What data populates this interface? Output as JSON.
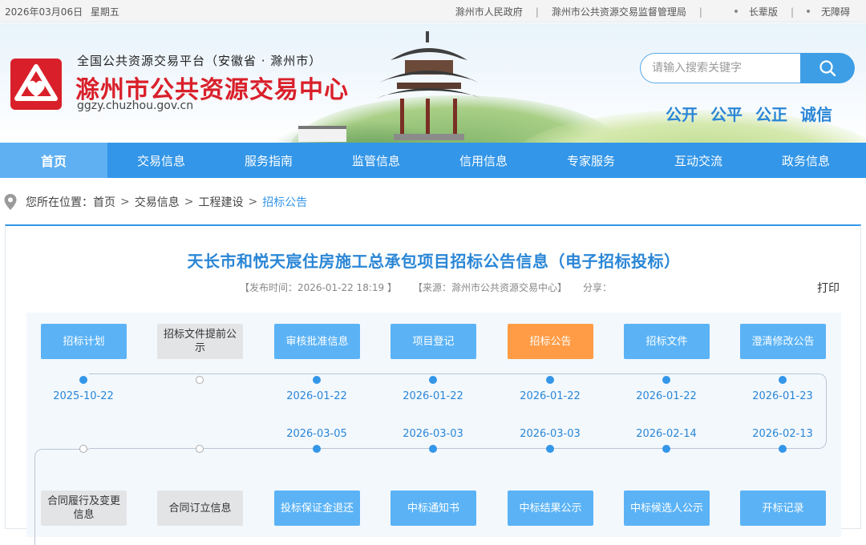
{
  "topbar": {
    "date": "2026年03月06日",
    "weekday": "星期五",
    "links": [
      "滁州市人民政府",
      "滁州市公共资源交易监督管理局"
    ],
    "elder_mode": "长辈版",
    "accessibility": "无障碍"
  },
  "header": {
    "platform_line": "全国公共资源交易平台（安徽省 · 滁州市）",
    "site_name": "滁州市公共资源交易中心",
    "url": "ggzy.chuzhou.gov.cn",
    "search_placeholder": "请输入搜索关键字",
    "slogan": [
      "公开",
      "公平",
      "公正",
      "诚信"
    ],
    "brand_color": "#d9202a",
    "icons": [
      "logo-emblem-icon",
      "search-icon",
      "pavilion-illustration"
    ]
  },
  "nav": {
    "items": [
      "首页",
      "交易信息",
      "服务指南",
      "监管信息",
      "信用信息",
      "专家服务",
      "互动交流",
      "政务信息"
    ],
    "active_index": 0,
    "color": "#3396e8"
  },
  "breadcrumb": {
    "prefix": "您所在位置：",
    "items": [
      "首页",
      "交易信息",
      "工程建设"
    ],
    "current": "招标公告",
    "separator": ">"
  },
  "article": {
    "title": "天长市和悦天宸住房施工总承包项目招标公告信息（电子招标投标）",
    "publish_time": "【发布时间：2026-01-22 18:19 】",
    "source": "【来源：滁州市公共资源交易中心】",
    "share": "分享：",
    "print": "打印"
  },
  "flow": {
    "row1": [
      {
        "label": "招标计划",
        "date": "2025-10-22",
        "state": "done"
      },
      {
        "label": "招标文件提前公示",
        "date": "",
        "state": "empty"
      },
      {
        "label": "审核批准信息",
        "date": "2026-01-22",
        "state": "done"
      },
      {
        "label": "项目登记",
        "date": "2026-01-22",
        "state": "done"
      },
      {
        "label": "招标公告",
        "date": "2026-01-22",
        "state": "current"
      },
      {
        "label": "招标文件",
        "date": "2026-01-22",
        "state": "done"
      },
      {
        "label": "澄清修改公告",
        "date": "2026-01-23",
        "state": "done"
      }
    ],
    "row2": [
      {
        "label": "合同履行及变更信息",
        "date": "",
        "state": "empty"
      },
      {
        "label": "合同订立信息",
        "date": "",
        "state": "empty"
      },
      {
        "label": "投标保证金退还",
        "date": "2026-03-05",
        "state": "done"
      },
      {
        "label": "中标通知书",
        "date": "2026-03-03",
        "state": "done"
      },
      {
        "label": "中标结果公示",
        "date": "2026-03-03",
        "state": "done"
      },
      {
        "label": "中标候选人公示",
        "date": "2026-02-14",
        "state": "done"
      },
      {
        "label": "开标记录",
        "date": "2026-02-13",
        "state": "done"
      }
    ],
    "colors": {
      "done": "#5bb3f6",
      "current": "#ff9c45",
      "empty": "#e3e4e6"
    }
  }
}
